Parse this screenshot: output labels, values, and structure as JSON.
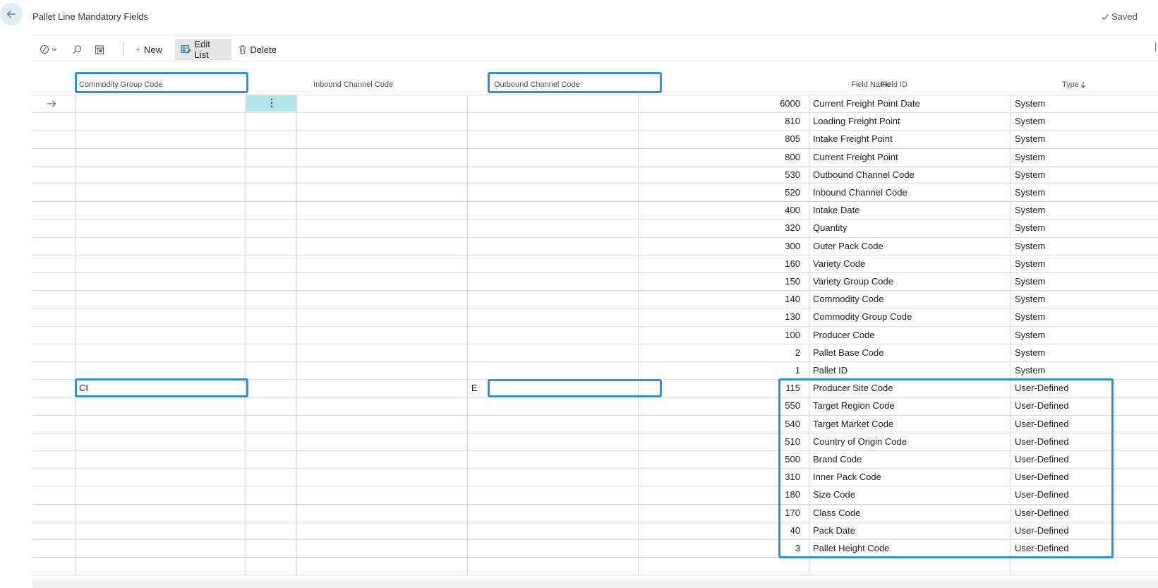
{
  "header": {
    "title": "Pallet Line Mandatory Fields",
    "saved_label": "Saved",
    "back_icon": "arrow-left-icon"
  },
  "toolbar": {
    "filter_icon": "filter-pane-icon",
    "search_icon": "search-icon",
    "layout_icon": "layout-icon",
    "new_label": "New",
    "edit_list_label": "Edit List",
    "delete_label": "Delete"
  },
  "columns": {
    "commodity_group_code": "Commodity Group Code",
    "inbound_channel_code": "Inbound Channel Code",
    "outbound_channel_code": "Outbound Channel Code",
    "field_id": "Field ID",
    "field_name": "Field Name",
    "type": "Type"
  },
  "rows": [
    {
      "commodity_group_code": "",
      "inbound_channel_code": "",
      "outbound_channel_code": "",
      "field_id": "6000",
      "field_name": "Current Freight Point Date",
      "type": "System"
    },
    {
      "commodity_group_code": "",
      "inbound_channel_code": "",
      "outbound_channel_code": "",
      "field_id": "810",
      "field_name": "Loading Freight Point",
      "type": "System"
    },
    {
      "commodity_group_code": "",
      "inbound_channel_code": "",
      "outbound_channel_code": "",
      "field_id": "805",
      "field_name": "Intake Freight Point",
      "type": "System"
    },
    {
      "commodity_group_code": "",
      "inbound_channel_code": "",
      "outbound_channel_code": "",
      "field_id": "800",
      "field_name": "Current Freight Point",
      "type": "System"
    },
    {
      "commodity_group_code": "",
      "inbound_channel_code": "",
      "outbound_channel_code": "",
      "field_id": "530",
      "field_name": "Outbound Channel Code",
      "type": "System"
    },
    {
      "commodity_group_code": "",
      "inbound_channel_code": "",
      "outbound_channel_code": "",
      "field_id": "520",
      "field_name": "Inbound Channel Code",
      "type": "System"
    },
    {
      "commodity_group_code": "",
      "inbound_channel_code": "",
      "outbound_channel_code": "",
      "field_id": "400",
      "field_name": "Intake Date",
      "type": "System"
    },
    {
      "commodity_group_code": "",
      "inbound_channel_code": "",
      "outbound_channel_code": "",
      "field_id": "320",
      "field_name": "Quantity",
      "type": "System"
    },
    {
      "commodity_group_code": "",
      "inbound_channel_code": "",
      "outbound_channel_code": "",
      "field_id": "300",
      "field_name": "Outer Pack Code",
      "type": "System"
    },
    {
      "commodity_group_code": "",
      "inbound_channel_code": "",
      "outbound_channel_code": "",
      "field_id": "160",
      "field_name": "Variety Code",
      "type": "System"
    },
    {
      "commodity_group_code": "",
      "inbound_channel_code": "",
      "outbound_channel_code": "",
      "field_id": "150",
      "field_name": "Variety Group Code",
      "type": "System"
    },
    {
      "commodity_group_code": "",
      "inbound_channel_code": "",
      "outbound_channel_code": "",
      "field_id": "140",
      "field_name": "Commodity Code",
      "type": "System"
    },
    {
      "commodity_group_code": "",
      "inbound_channel_code": "",
      "outbound_channel_code": "",
      "field_id": "130",
      "field_name": "Commodity Group Code",
      "type": "System"
    },
    {
      "commodity_group_code": "",
      "inbound_channel_code": "",
      "outbound_channel_code": "",
      "field_id": "100",
      "field_name": "Producer Code",
      "type": "System"
    },
    {
      "commodity_group_code": "",
      "inbound_channel_code": "",
      "outbound_channel_code": "",
      "field_id": "2",
      "field_name": "Pallet Base Code",
      "type": "System"
    },
    {
      "commodity_group_code": "",
      "inbound_channel_code": "",
      "outbound_channel_code": "",
      "field_id": "1",
      "field_name": "Pallet ID",
      "type": "System"
    },
    {
      "commodity_group_code": "CI",
      "inbound_channel_code": "",
      "outbound_channel_code": "E",
      "field_id": "115",
      "field_name": "Producer Site Code",
      "type": "User-Defined"
    },
    {
      "commodity_group_code": "",
      "inbound_channel_code": "",
      "outbound_channel_code": "",
      "field_id": "550",
      "field_name": "Target Region Code",
      "type": "User-Defined"
    },
    {
      "commodity_group_code": "",
      "inbound_channel_code": "",
      "outbound_channel_code": "",
      "field_id": "540",
      "field_name": "Target Market Code",
      "type": "User-Defined"
    },
    {
      "commodity_group_code": "",
      "inbound_channel_code": "",
      "outbound_channel_code": "",
      "field_id": "510",
      "field_name": "Country of Origin Code",
      "type": "User-Defined"
    },
    {
      "commodity_group_code": "",
      "inbound_channel_code": "",
      "outbound_channel_code": "",
      "field_id": "500",
      "field_name": "Brand Code",
      "type": "User-Defined"
    },
    {
      "commodity_group_code": "",
      "inbound_channel_code": "",
      "outbound_channel_code": "",
      "field_id": "310",
      "field_name": "Inner Pack Code",
      "type": "User-Defined"
    },
    {
      "commodity_group_code": "",
      "inbound_channel_code": "",
      "outbound_channel_code": "",
      "field_id": "180",
      "field_name": "Size Code",
      "type": "User-Defined"
    },
    {
      "commodity_group_code": "",
      "inbound_channel_code": "",
      "outbound_channel_code": "",
      "field_id": "170",
      "field_name": "Class Code",
      "type": "User-Defined"
    },
    {
      "commodity_group_code": "",
      "inbound_channel_code": "",
      "outbound_channel_code": "",
      "field_id": "40",
      "field_name": "Pack Date",
      "type": "User-Defined"
    },
    {
      "commodity_group_code": "",
      "inbound_channel_code": "",
      "outbound_channel_code": "",
      "field_id": "3",
      "field_name": "Pallet Height Code",
      "type": "User-Defined"
    },
    {
      "commodity_group_code": "",
      "inbound_channel_code": "",
      "outbound_channel_code": "",
      "field_id": "",
      "field_name": "",
      "type": ""
    }
  ],
  "colors": {
    "accent": "#2f8fdc",
    "menu_cell": "#b3e5ea",
    "teal": "#00838f"
  }
}
